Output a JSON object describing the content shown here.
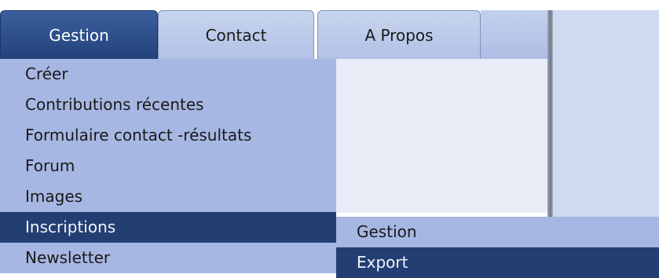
{
  "tabs": [
    {
      "label": "Gestion",
      "active": true
    },
    {
      "label": "Contact",
      "active": false
    },
    {
      "label": "A Propos",
      "active": false
    }
  ],
  "menu": {
    "items": [
      {
        "label": "Créer"
      },
      {
        "label": "Contributions récentes"
      },
      {
        "label": "Formulaire contact -résultats"
      },
      {
        "label": "Forum"
      },
      {
        "label": "Images"
      },
      {
        "label": "Inscriptions",
        "highlighted": true
      },
      {
        "label": "Newsletter"
      }
    ]
  },
  "submenu": {
    "items": [
      {
        "label": "Gestion"
      },
      {
        "label": "Export",
        "highlighted": true
      }
    ]
  },
  "colors": {
    "active_tab": "#2b4a84",
    "menu_background": "#a7b7e3",
    "highlight": "#233e72",
    "panel_background": "#cfd9ef"
  }
}
